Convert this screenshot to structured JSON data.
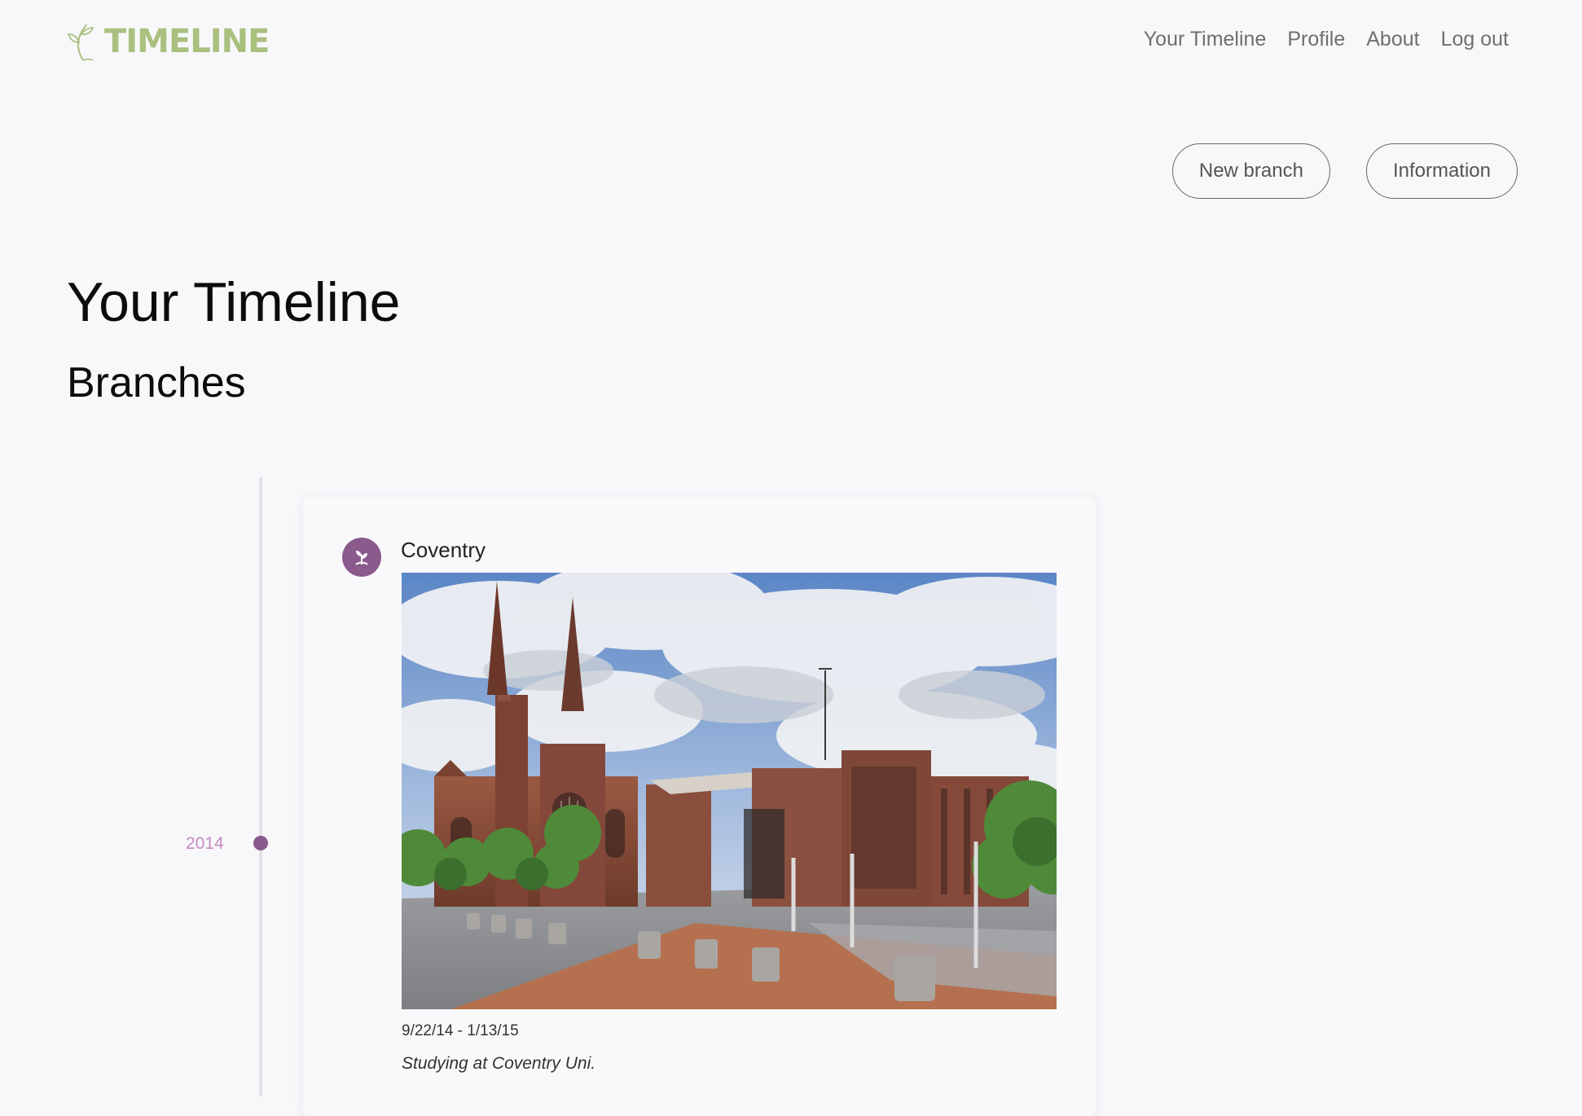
{
  "brand": {
    "name": "TIMELINE",
    "accent": "#a9c07e"
  },
  "nav": {
    "items": [
      "Your Timeline",
      "Profile",
      "About",
      "Log out"
    ]
  },
  "actions": {
    "new_branch": "New branch",
    "information": "Information"
  },
  "page": {
    "title": "Your Timeline",
    "section": "Branches"
  },
  "timeline": {
    "year": "2014",
    "branch": {
      "title": "Coventry",
      "icon": "sprout-icon",
      "dates": "9/22/14 - 1/13/15",
      "description": "Studying at Coventry Uni.",
      "color": "#8a5a8c"
    }
  }
}
